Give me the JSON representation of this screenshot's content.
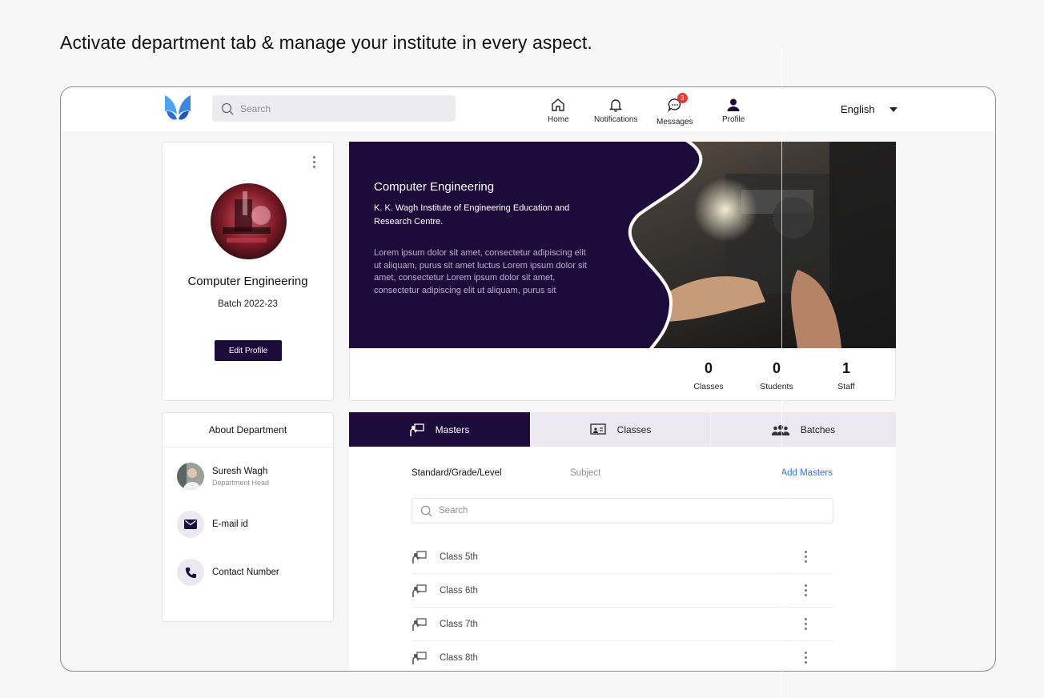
{
  "headline": "Activate department tab & manage your institute in every aspect.",
  "topbar": {
    "search_placeholder": "Search",
    "nav": [
      {
        "label": "Home",
        "icon": "home-icon"
      },
      {
        "label": "Notifications",
        "icon": "bell-icon"
      },
      {
        "label": "Messages",
        "icon": "chat-icon",
        "badge": "3"
      },
      {
        "label": "Profile",
        "icon": "user-icon"
      }
    ],
    "language": "English"
  },
  "profile_card": {
    "title": "Computer Engineering",
    "batch": "Batch 2022-23",
    "edit_button": "Edit Profile"
  },
  "about": {
    "title": "About Department",
    "head_name": "Suresh Wagh",
    "head_role": "Department Head",
    "email_label": "E-mail id",
    "contact_label": "Contact Number"
  },
  "hero": {
    "title": "Computer Engineering",
    "institute": "K. K. Wagh Institute of Engineering Education and Research Centre.",
    "description": "Lorem ipsum dolor sit amet, consectetur adipiscing elit ut aliquam, purus sit amet luctus Lorem ipsum dolor sit amet, consectetur Lorem ipsum dolor sit amet, consectetur adipiscing elit ut aliquam, purus sit"
  },
  "stats": [
    {
      "value": "0",
      "label": "Classes"
    },
    {
      "value": "0",
      "label": "Students"
    },
    {
      "value": "1",
      "label": "Staff"
    }
  ],
  "tabs": [
    {
      "label": "Masters",
      "active": true
    },
    {
      "label": "Classes",
      "active": false
    },
    {
      "label": "Batches",
      "active": false
    }
  ],
  "masters": {
    "col_standard": "Standard/Grade/Level",
    "col_subject": "Subject",
    "add_link": "Add Masters",
    "search_placeholder": "Search",
    "rows": [
      "Class 5th",
      "Class 6th",
      "Class 7th",
      "Class 8th"
    ]
  },
  "colors": {
    "primary": "#1d0c3b",
    "tab_inactive": "#ece8f2",
    "link": "#3a6fe0",
    "badge": "#e53935"
  }
}
